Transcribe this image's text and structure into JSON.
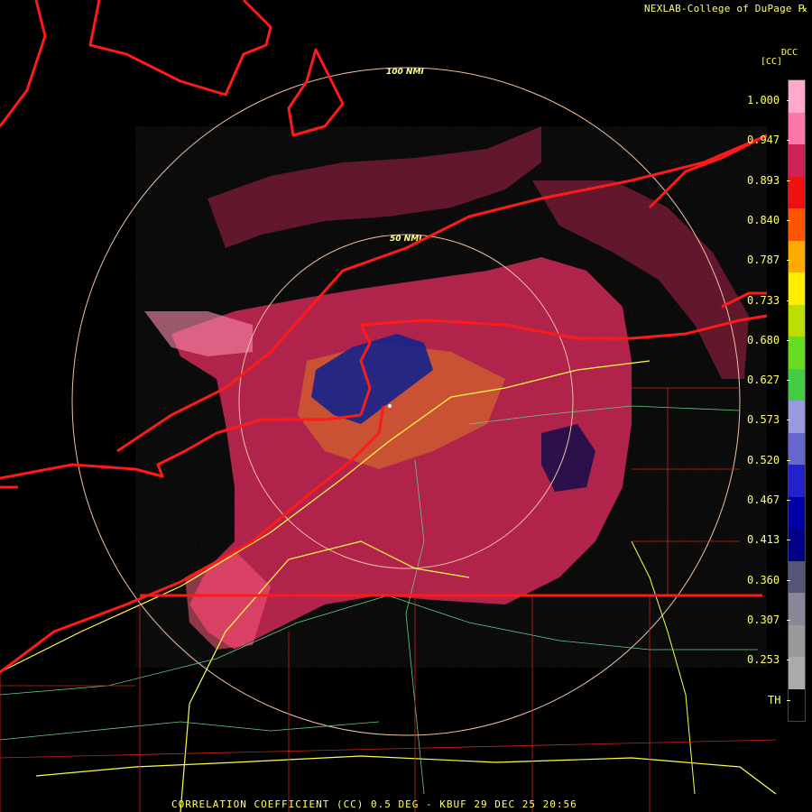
{
  "header": {
    "credit": "NEXLAB-College of DuPage",
    "credit_icon": "k-logo-icon",
    "product_abbrev": "DCC",
    "unit": "[CC]"
  },
  "range_rings": {
    "outer_label": "100 NMI",
    "inner_label": "50 NMI"
  },
  "colorbar": {
    "ticks": [
      "1.000",
      "0.947",
      "0.893",
      "0.840",
      "0.787",
      "0.733",
      "0.680",
      "0.627",
      "0.573",
      "0.520",
      "0.467",
      "0.413",
      "0.360",
      "0.307",
      "0.253",
      "TH"
    ],
    "colors": [
      "#ffaacc",
      "#ff77aa",
      "#cc2255",
      "#ee1111",
      "#ff5500",
      "#ffaa00",
      "#ffee00",
      "#bbdd00",
      "#66dd22",
      "#44cc44",
      "#9999dd",
      "#6666cc",
      "#2222cc",
      "#0000aa",
      "#000088",
      "#555577",
      "#888899",
      "#999999",
      "#aaaaaa",
      "#000000"
    ]
  },
  "footer": {
    "caption": "CORRELATION COEFFICIENT (CC) 0.5 DEG - KBUF 29 DEC 25 20:56"
  },
  "colors": {
    "text": "#ffff66",
    "borders": "#ff1a1a",
    "counties": "#cc2222",
    "highways": "#ffff44",
    "roads": "#66cc88",
    "echo_main": "#b01a44",
    "ring": "#f0c0a0"
  }
}
